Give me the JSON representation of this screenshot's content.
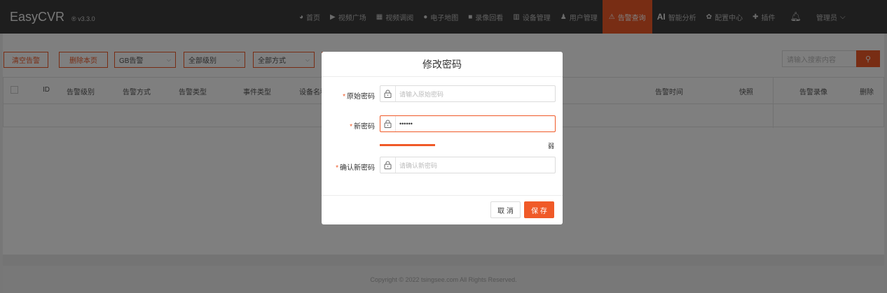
{
  "app": {
    "name": "EasyCVR",
    "version": "v3.3.0"
  },
  "nav": {
    "items": [
      {
        "label": "首页",
        "icon": "dashboard-icon",
        "glyph": "◕"
      },
      {
        "label": "视频广场",
        "icon": "play-icon",
        "glyph": "▶"
      },
      {
        "label": "视频调阅",
        "icon": "grid-icon",
        "glyph": "▦"
      },
      {
        "label": "电子地图",
        "icon": "map-pin-icon",
        "glyph": "⬤"
      },
      {
        "label": "录像回看",
        "icon": "video-camera-icon",
        "glyph": "■"
      },
      {
        "label": "设备管理",
        "icon": "device-icon",
        "glyph": "▥"
      },
      {
        "label": "用户管理",
        "icon": "user-icon",
        "glyph": "♟"
      },
      {
        "label": "告警查询",
        "icon": "alarm-icon",
        "glyph": "⚠",
        "active": true
      },
      {
        "label": "智能分析",
        "icon": "ai-icon",
        "glyph": "AI"
      },
      {
        "label": "配置中心",
        "icon": "settings-icon",
        "glyph": "✿"
      },
      {
        "label": "插件",
        "icon": "plugin-icon",
        "glyph": "✚"
      }
    ],
    "user_label": "管理员"
  },
  "toolbar": {
    "clear_label": "清空告警",
    "delete_page_label": "删除本页",
    "source_select": "GB告警",
    "level_select": "全部级别",
    "method_select": "全部方式",
    "search_placeholder": "请输入搜索内容"
  },
  "table": {
    "columns": [
      "ID",
      "告警级别",
      "告警方式",
      "告警类型",
      "事件类型",
      "设备名称",
      "告警时间",
      "快照",
      "告警录像",
      "删除"
    ]
  },
  "footer": {
    "copyright": "Copyright © 2022 tsingsee.com All Rights Reserved."
  },
  "modal": {
    "title": "修改密码",
    "old_password_label": "原始密码",
    "old_password_placeholder": "请输入原始密码",
    "new_password_label": "新密码",
    "new_password_value": "••••••",
    "strength_label": "弱",
    "confirm_password_label": "确认新密码",
    "confirm_password_placeholder": "请确认新密码",
    "cancel_label": "取 消",
    "save_label": "保 存",
    "required_mark": "*"
  },
  "colors": {
    "accent": "#f05a28",
    "navbar": "#3d3d3d"
  }
}
